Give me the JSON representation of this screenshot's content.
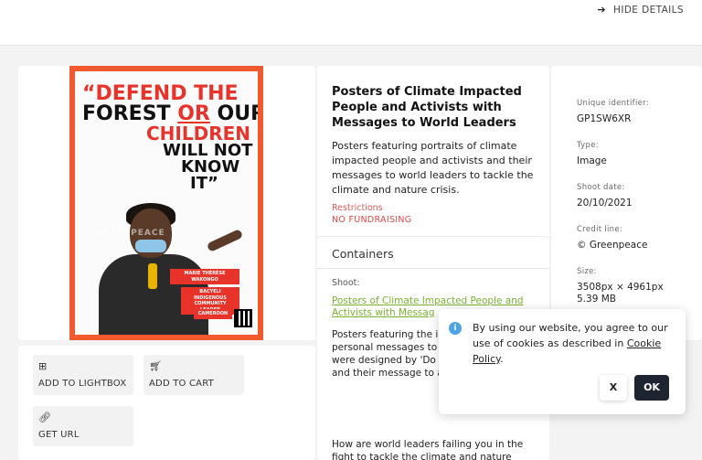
{
  "header": {
    "hide_details_label": "HIDE DETAILS",
    "hide_details_icon": "arrow-right-icon"
  },
  "poster": {
    "quote_lines": [
      "“DEFEND THE",
      "FOREST OR OUR",
      "CHILDREN",
      "WILL NOT",
      "KNOW",
      "IT”"
    ],
    "watermark": "GREENPEACE",
    "name_label": "MARIE THÉRÈSE WAKONGO",
    "role_label": "BACYELI INDIGENOUS COMMUNITY LEADER",
    "country_label": "CAMEROON",
    "accent": "#f15a2e"
  },
  "actions": {
    "lightbox": {
      "label": "ADD TO LIGHTBOX",
      "icon": "plus-square-icon"
    },
    "cart": {
      "label": "ADD TO CART",
      "icon": "cart-icon"
    },
    "url": {
      "label": "GET URL",
      "icon": "link-icon"
    }
  },
  "description": {
    "title": "Posters of Climate Impacted People and Activists with Messages to World Leaders",
    "text": "Posters featuring portraits of climate impacted people and activists and their messages to world leaders to tackle the climate and nature crisis.",
    "restrictions_label": "Restrictions",
    "restrictions_value": "NO FUNDRAISING"
  },
  "containers": {
    "heading": "Containers",
    "shoot_label": "Shoot:",
    "shoot_link": "Posters of Climate Impacted People and Activists with Messag",
    "text": "Posters featuring the impacted people and personal messages to tackling the climate c were designed by 'Do and are comprised of and their message to answering the question:",
    "text2": "How are world leaders failing you in the fight to tackle the climate and nature"
  },
  "details": {
    "uid_label": "Unique identifier:",
    "uid_value": "GP1SW6XR",
    "type_label": "Type:",
    "type_value": "Image",
    "date_label": "Shoot date:",
    "date_value": "20/10/2021",
    "credit_label": "Credit line:",
    "credit_value": "© Greenpeace",
    "size_label": "Size:",
    "size_px": "3508px × 4961px",
    "size_mb": "5.39 MB"
  },
  "cookie": {
    "icon": "info-icon",
    "text_before": "By using our website, you agree to our use of cookies as described in",
    "link": "Cookie Policy",
    "text_after": ".",
    "close_label": "X",
    "ok_label": "OK"
  }
}
